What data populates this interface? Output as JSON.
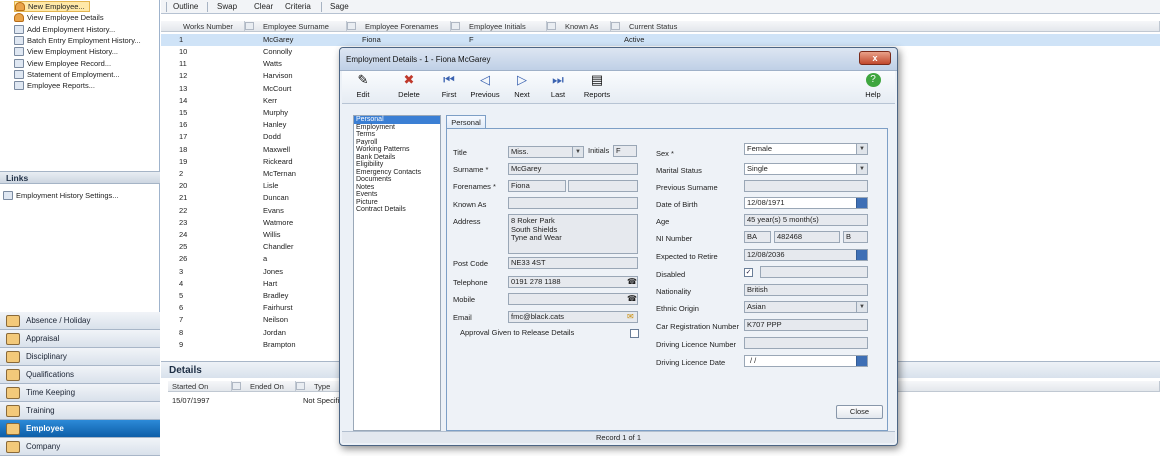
{
  "tasks": [
    {
      "label": "New Employee...",
      "icon": "person-icon",
      "selected": true
    },
    {
      "label": "View Employee Details",
      "icon": "person-icon"
    },
    {
      "label": "Add Employment History...",
      "icon": "document-icon"
    },
    {
      "label": "Batch Entry Employment History...",
      "icon": "document-icon"
    },
    {
      "label": "View Employment History...",
      "icon": "document-icon"
    },
    {
      "label": "View Employee Record...",
      "icon": "gear-icon"
    },
    {
      "label": "Statement of Employment...",
      "icon": "document-icon"
    },
    {
      "label": "Employee Reports...",
      "icon": "report-icon"
    }
  ],
  "links": {
    "title": "Links",
    "items": [
      "Employment History Settings..."
    ]
  },
  "nav": [
    "Absence / Holiday",
    "Appraisal",
    "Disciplinary",
    "Qualifications",
    "Time Keeping",
    "Training",
    "Employee",
    "Company"
  ],
  "nav_active": "Employee",
  "toolbar": [
    "Outline",
    "Swap",
    "Clear",
    "Criteria",
    "Sage"
  ],
  "grid": {
    "headers": [
      "Works Number",
      "Employee Surname",
      "Employee Forenames",
      "Employee Initials",
      "Known As",
      "Current Status"
    ],
    "first_row": {
      "works": "1",
      "surname": "McGarey",
      "forenames": "Fiona",
      "initials": "F",
      "status": "Active"
    },
    "rows": [
      [
        "10",
        "Connolly"
      ],
      [
        "11",
        "Watts"
      ],
      [
        "12",
        "Harvison"
      ],
      [
        "13",
        "McCourt"
      ],
      [
        "14",
        "Kerr"
      ],
      [
        "15",
        "Murphy"
      ],
      [
        "16",
        "Hanley"
      ],
      [
        "17",
        "Dodd"
      ],
      [
        "18",
        "Maxwell"
      ],
      [
        "19",
        "Rickeard"
      ],
      [
        "2",
        "McTernan"
      ],
      [
        "20",
        "Lisle"
      ],
      [
        "21",
        "Duncan"
      ],
      [
        "22",
        "Evans"
      ],
      [
        "23",
        "Watmore"
      ],
      [
        "24",
        "Willis"
      ],
      [
        "25",
        "Chandler"
      ],
      [
        "26",
        "a"
      ],
      [
        "3",
        "Jones"
      ],
      [
        "4",
        "Hart"
      ],
      [
        "5",
        "Bradley"
      ],
      [
        "6",
        "Fairhurst"
      ],
      [
        "7",
        "Neilson"
      ],
      [
        "8",
        "Jordan"
      ],
      [
        "9",
        "Brampton"
      ]
    ]
  },
  "details": {
    "title": "Details",
    "headers": [
      "Started On",
      "Ended On",
      "Type"
    ],
    "row": {
      "started": "15/07/1997",
      "type": "Not Specifi"
    }
  },
  "dialog": {
    "title": "Employment Details - 1 - Fiona McGarey",
    "close": "x",
    "tools": [
      "Edit",
      "Delete",
      "First",
      "Previous",
      "Next",
      "Last",
      "Reports",
      "Help"
    ],
    "sections": [
      "Personal",
      "Employment",
      "Terms",
      "Payroll",
      "Working Patterns",
      "Bank Details",
      "Eligibility",
      "Emergency Contacts",
      "Documents",
      "Notes",
      "Events",
      "Picture",
      "Contract Details"
    ],
    "tab": "Personal",
    "left": {
      "title_label": "Title",
      "title": "Miss.",
      "initials_label": "Initials",
      "initials": "F",
      "surname_label": "Surname *",
      "surname": "McGarey",
      "forenames_label": "Forenames *",
      "forenames": "Fiona",
      "known_as_label": "Known As",
      "known_as": "",
      "address_label": "Address",
      "address": [
        "8 Roker Park",
        "South Shields",
        "Tyne and Wear"
      ],
      "postcode_label": "Post Code",
      "postcode": "NE33 4ST",
      "telephone_label": "Telephone",
      "telephone": "0191 278 1188",
      "mobile_label": "Mobile",
      "mobile": "",
      "email_label": "Email",
      "email": "fmc@black.cats",
      "approval_label": "Approval Given to Release Details"
    },
    "right": {
      "sex_label": "Sex *",
      "sex": "Female",
      "marital_label": "Marital Status",
      "marital": "Single",
      "prev_surname_label": "Previous Surname",
      "prev_surname": "",
      "dob_label": "Date of Birth",
      "dob": "12/08/1971",
      "age_label": "Age",
      "age": "45 year(s) 5 month(s)",
      "ni_label": "NI Number",
      "ni": [
        "BA",
        "482468",
        "B"
      ],
      "retire_label": "Expected to Retire",
      "retire": "12/08/2036",
      "disabled_label": "Disabled",
      "disabled": true,
      "nationality_label": "Nationality",
      "nationality": "British",
      "ethnic_label": "Ethnic Origin",
      "ethnic": "Asian",
      "car_label": "Car Registration Number",
      "car": "K707 PPP",
      "licence_no_label": "Driving Licence Number",
      "licence_no": "",
      "licence_date_label": "Driving Licence Date",
      "licence_date": "/ /"
    },
    "close_button": "Close",
    "status": "Record 1 of 1"
  }
}
